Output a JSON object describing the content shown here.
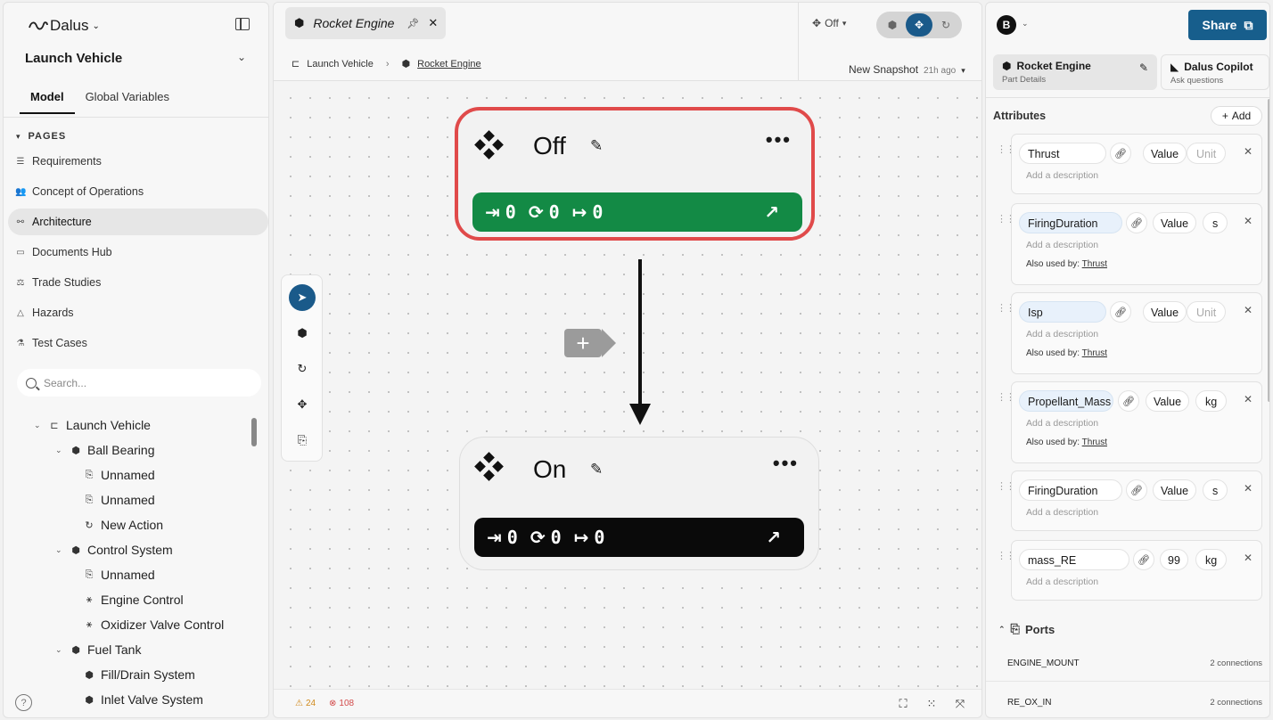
{
  "app": {
    "brand": "Dalus"
  },
  "left": {
    "project": "Launch Vehicle",
    "tabs": [
      "Model",
      "Global Variables"
    ],
    "pages_header": "PAGES",
    "pages": [
      "Requirements",
      "Concept of Operations",
      "Architecture",
      "Documents Hub",
      "Trade Studies",
      "Hazards",
      "Test Cases"
    ],
    "search_placeholder": "Search...",
    "tree": [
      "Launch Vehicle",
      "Ball Bearing",
      "Unnamed",
      "Unnamed",
      "New Action",
      "Control System",
      "Unnamed",
      "Engine Control",
      "Oxidizer Valve Control",
      "Fuel Tank",
      "Fill/Drain System",
      "Inlet Valve System"
    ],
    "help": "?"
  },
  "center": {
    "tab_title": "Rocket Engine",
    "breadcrumb": [
      "Launch Vehicle",
      "Rocket Engine"
    ],
    "state_select": "Off",
    "snapshot": "New Snapshot",
    "snapshot_ago": "21h ago",
    "states": [
      {
        "name": "Off",
        "entry": "0",
        "do": "0",
        "exit": "0"
      },
      {
        "name": "On",
        "entry": "0",
        "do": "0",
        "exit": "0"
      }
    ],
    "warnings": "24",
    "errors": "108"
  },
  "right": {
    "avatar": "B",
    "share_label": "Share",
    "tabs": [
      {
        "title": "Rocket Engine",
        "subtitle": "Part Details"
      },
      {
        "title": "Dalus Copilot",
        "subtitle": "Ask questions"
      }
    ],
    "attributes_title": "Attributes",
    "add_label": "Add",
    "desc_placeholder": "Add a description",
    "used_by_label": "Also used by:",
    "attributes": [
      {
        "name": "Thrust",
        "value": "Value",
        "unit": "Unit",
        "used_by": ""
      },
      {
        "name": "FiringDuration",
        "value": "Value",
        "unit": "s",
        "used_by": "Thrust"
      },
      {
        "name": "Isp",
        "value": "Value",
        "unit": "Unit",
        "used_by": "Thrust"
      },
      {
        "name": "Propellant_Mass",
        "value": "Value",
        "unit": "kg",
        "used_by": "Thrust"
      },
      {
        "name": "FiringDuration",
        "value": "Value",
        "unit": "s",
        "used_by": ""
      },
      {
        "name": "mass_RE",
        "value": "99",
        "unit": "kg",
        "used_by": ""
      }
    ],
    "ports_title": "Ports",
    "ports": [
      {
        "name": "ENGINE_MOUNT",
        "connections": "2 connections"
      },
      {
        "name": "RE_OX_IN",
        "connections": "2 connections"
      }
    ]
  },
  "colors": {
    "accent": "#175e8c",
    "selected_border": "#e04a4a",
    "state_active": "#138a45",
    "state_inactive": "#0a0a0a"
  }
}
